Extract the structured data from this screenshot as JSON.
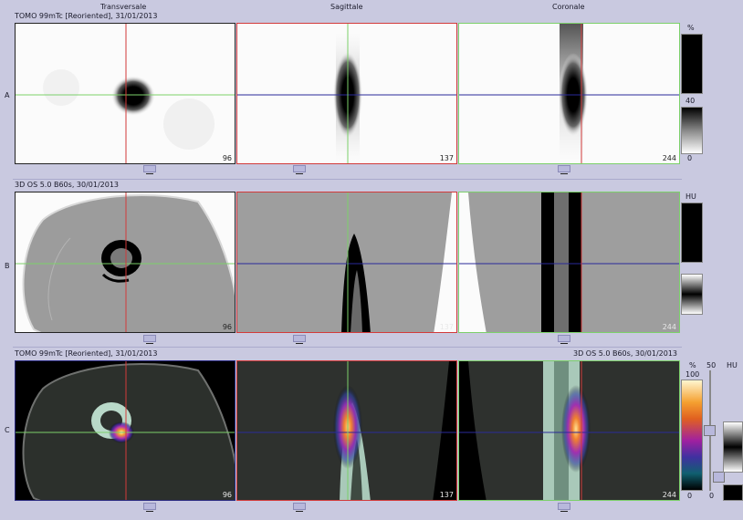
{
  "columns": {
    "transversale": "Transversale",
    "sagittale": "Sagittale",
    "coronale": "Coronale"
  },
  "rows": {
    "a": {
      "label": "A",
      "title": "TOMO 99mTc [Reoriented], 31/01/2013"
    },
    "b": {
      "label": "B",
      "title": "3D OS 5.0 B60s, 30/01/2013"
    },
    "c": {
      "label": "C",
      "title_left": "TOMO 99mTc [Reoriented], 31/01/2013",
      "title_right": "3D OS 5.0 B60s, 30/01/2013"
    }
  },
  "slices": {
    "transversale": "96",
    "sagittale": "137",
    "coronale": "244"
  },
  "scales": {
    "a_unit": "%",
    "a_mid": "40",
    "a_min": "0",
    "b_unit": "HU",
    "c_unit": "%",
    "c_max": "100",
    "c_min": "0",
    "c_window": "50",
    "c_window_min": "0",
    "c_hu_unit": "HU"
  },
  "colors": {
    "crosshair_vertical": "#d23a3a",
    "crosshair_horizontal_a": "#7cd06a",
    "crosshair_horizontal_b": "#2a2a9a",
    "background": "#c9c9e0"
  }
}
